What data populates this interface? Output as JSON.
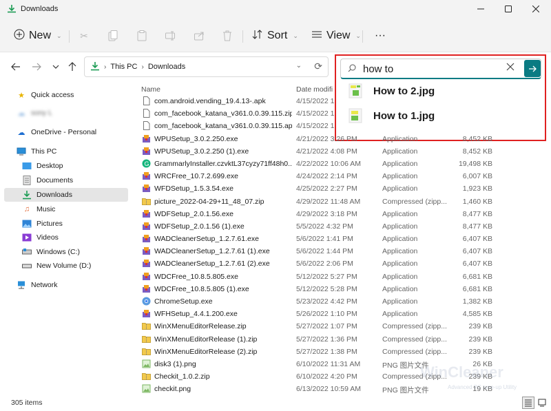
{
  "window": {
    "title": "Downloads"
  },
  "toolbar": {
    "new_label": "New",
    "sort_label": "Sort",
    "view_label": "View",
    "more_label": "···"
  },
  "address": {
    "crumbs": [
      "This PC",
      "Downloads"
    ]
  },
  "search": {
    "query": "how to",
    "results": [
      {
        "name": "How to 2.jpg"
      },
      {
        "name": "How to 1.jpg"
      }
    ]
  },
  "sidebar": {
    "items": [
      {
        "label": "Quick access",
        "icon": "star-icon"
      },
      {
        "label": "sony L",
        "icon": "cloud-icon"
      },
      {
        "label": "OneDrive - Personal",
        "icon": "cloud-icon"
      },
      {
        "label": "This PC",
        "icon": "pc-icon"
      },
      {
        "label": "Desktop",
        "icon": "desktop-icon"
      },
      {
        "label": "Documents",
        "icon": "documents-icon"
      },
      {
        "label": "Downloads",
        "icon": "downloads-icon"
      },
      {
        "label": "Music",
        "icon": "music-icon"
      },
      {
        "label": "Pictures",
        "icon": "pictures-icon"
      },
      {
        "label": "Videos",
        "icon": "videos-icon"
      },
      {
        "label": "Windows (C:)",
        "icon": "drive-icon"
      },
      {
        "label": "New Volume (D:)",
        "icon": "drive-icon"
      },
      {
        "label": "Network",
        "icon": "network-icon"
      }
    ]
  },
  "columns": {
    "name": "Name",
    "date": "Date modifi"
  },
  "files": [
    {
      "name": "com.android.vending_19.4.13-.apk",
      "date": "4/15/2022 1",
      "type": "",
      "size": "",
      "icon": "file"
    },
    {
      "name": "com_facebook_katana_v361.0.0.39.115.zip",
      "date": "4/15/2022 1",
      "type": "",
      "size": "",
      "icon": "file"
    },
    {
      "name": "com_facebook_katana_v361.0.0.39.115.apk",
      "date": "4/15/2022 1",
      "type": "",
      "size": "",
      "icon": "file"
    },
    {
      "name": "WPUSetup_3.0.2.250.exe",
      "date": "4/21/2022 3:26 PM",
      "type": "Application",
      "size": "8,452 KB",
      "icon": "setup"
    },
    {
      "name": "WPUSetup_3.0.2.250 (1).exe",
      "date": "4/21/2022 4:08 PM",
      "type": "Application",
      "size": "8,452 KB",
      "icon": "setup"
    },
    {
      "name": "GrammarlyInstaller.czvktL37cyzy71ff48h0...",
      "date": "4/22/2022 10:06 AM",
      "type": "Application",
      "size": "19,498 KB",
      "icon": "grammarly"
    },
    {
      "name": "WRCFree_10.7.2.699.exe",
      "date": "4/24/2022 2:14 PM",
      "type": "Application",
      "size": "6,007 KB",
      "icon": "setup"
    },
    {
      "name": "WFDSetup_1.5.3.54.exe",
      "date": "4/25/2022 2:27 PM",
      "type": "Application",
      "size": "1,923 KB",
      "icon": "setup"
    },
    {
      "name": "picture_2022-04-29+11_48_07.zip",
      "date": "4/29/2022 11:48 AM",
      "type": "Compressed (zipp...",
      "size": "1,460 KB",
      "icon": "zip"
    },
    {
      "name": "WDFSetup_2.0.1.56.exe",
      "date": "4/29/2022 3:18 PM",
      "type": "Application",
      "size": "8,477 KB",
      "icon": "setup"
    },
    {
      "name": "WDFSetup_2.0.1.56 (1).exe",
      "date": "5/5/2022 4:32 PM",
      "type": "Application",
      "size": "8,477 KB",
      "icon": "setup"
    },
    {
      "name": "WADCleanerSetup_1.2.7.61.exe",
      "date": "5/6/2022 1:41 PM",
      "type": "Application",
      "size": "6,407 KB",
      "icon": "setup"
    },
    {
      "name": "WADCleanerSetup_1.2.7.61 (1).exe",
      "date": "5/6/2022 1:44 PM",
      "type": "Application",
      "size": "6,407 KB",
      "icon": "setup"
    },
    {
      "name": "WADCleanerSetup_1.2.7.61 (2).exe",
      "date": "5/6/2022 2:06 PM",
      "type": "Application",
      "size": "6,407 KB",
      "icon": "setup"
    },
    {
      "name": "WDCFree_10.8.5.805.exe",
      "date": "5/12/2022 5:27 PM",
      "type": "Application",
      "size": "6,681 KB",
      "icon": "setup"
    },
    {
      "name": "WDCFree_10.8.5.805 (1).exe",
      "date": "5/12/2022 5:28 PM",
      "type": "Application",
      "size": "6,681 KB",
      "icon": "setup"
    },
    {
      "name": "ChromeSetup.exe",
      "date": "5/23/2022 4:42 PM",
      "type": "Application",
      "size": "1,382 KB",
      "icon": "chrome"
    },
    {
      "name": "WFHSetup_4.4.1.200.exe",
      "date": "5/26/2022 1:10 PM",
      "type": "Application",
      "size": "4,585 KB",
      "icon": "setup"
    },
    {
      "name": "WinXMenuEditorRelease.zip",
      "date": "5/27/2022 1:07 PM",
      "type": "Compressed (zipp...",
      "size": "239 KB",
      "icon": "zip"
    },
    {
      "name": "WinXMenuEditorRelease (1).zip",
      "date": "5/27/2022 1:36 PM",
      "type": "Compressed (zipp...",
      "size": "239 KB",
      "icon": "zip"
    },
    {
      "name": "WinXMenuEditorRelease (2).zip",
      "date": "5/27/2022 1:38 PM",
      "type": "Compressed (zipp...",
      "size": "239 KB",
      "icon": "zip"
    },
    {
      "name": "disk3 (1).png",
      "date": "6/10/2022 11:31 AM",
      "type": "PNG 图片文件",
      "size": "26 KB",
      "icon": "png"
    },
    {
      "name": "Checkit_1.0.2.zip",
      "date": "6/10/2022 4:20 PM",
      "type": "Compressed (zipp...",
      "size": "239 KB",
      "icon": "zip"
    },
    {
      "name": "checkit.png",
      "date": "6/13/2022 10:59 AM",
      "type": "PNG 图片文件",
      "size": "19 KB",
      "icon": "png"
    }
  ],
  "status": {
    "count": "305 items"
  },
  "watermark": {
    "brand": "WinCleaner",
    "tagline": "Advanced PC tune-up Utility"
  },
  "colors": {
    "accent": "#0a7b83",
    "highlight": "#e02020"
  }
}
